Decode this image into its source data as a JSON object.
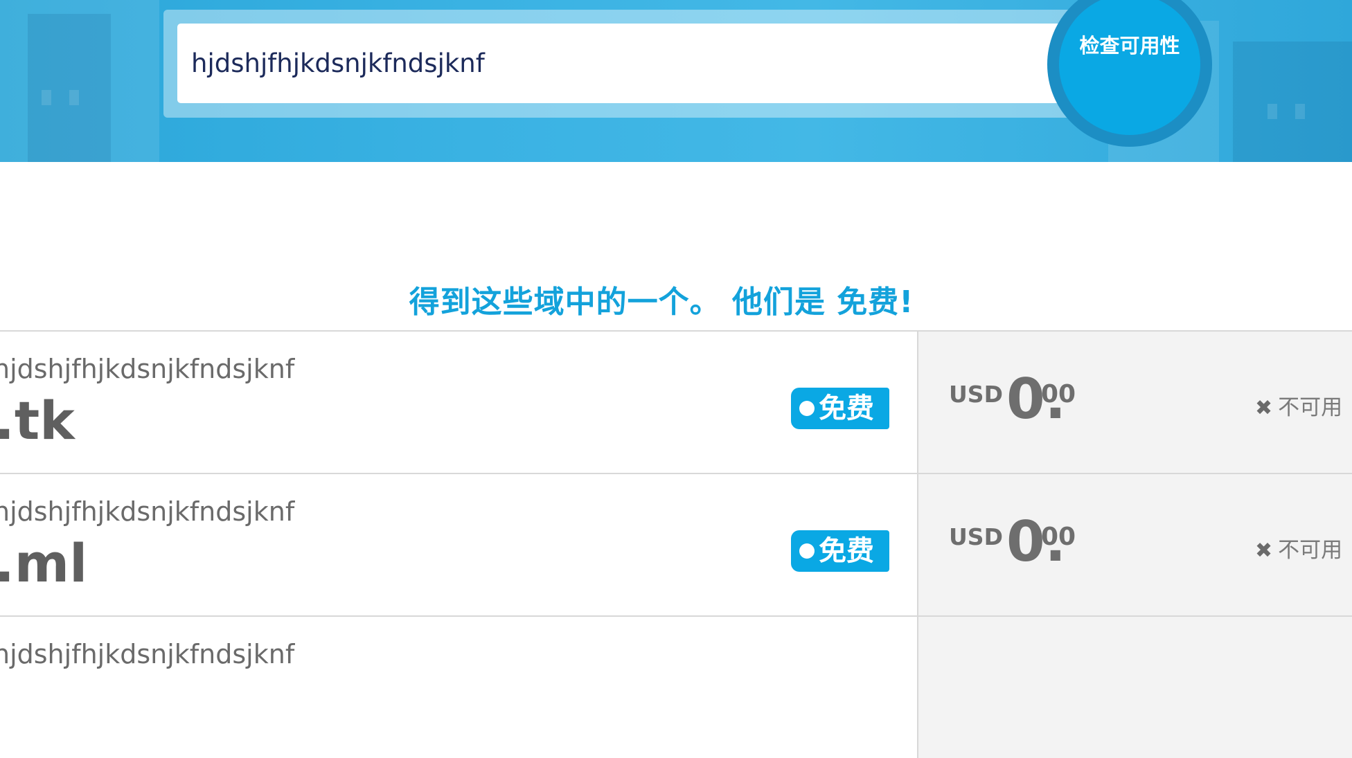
{
  "search": {
    "query": "hjdshjfhjkdsnjkfndsjknf",
    "button_label": "检查可用性"
  },
  "results_heading": "得到这些域中的一个。 他们是 免费!",
  "results": [
    {
      "sld": "hjdshjfhjkdsnjkfndsjknf",
      "tld": ".tk",
      "badge": "免费",
      "currency": "USD",
      "price_int": "0.",
      "price_dec": "00",
      "status": "不可用"
    },
    {
      "sld": "hjdshjfhjkdsnjkfndsjknf",
      "tld": ".ml",
      "badge": "免费",
      "currency": "USD",
      "price_int": "0.",
      "price_dec": "00",
      "status": "不可用"
    },
    {
      "sld": "hjdshjfhjkdsnjkfndsjknf",
      "tld": "",
      "badge": "",
      "currency": "",
      "price_int": "",
      "price_dec": "",
      "status": ""
    }
  ],
  "icons": {
    "unavailable": "close-icon"
  },
  "colors": {
    "accent": "#0aa8e4",
    "heading": "#13a2db",
    "hero": "#3ab2e3",
    "text": "#6e6e6e",
    "panel": "#f3f3f3"
  }
}
